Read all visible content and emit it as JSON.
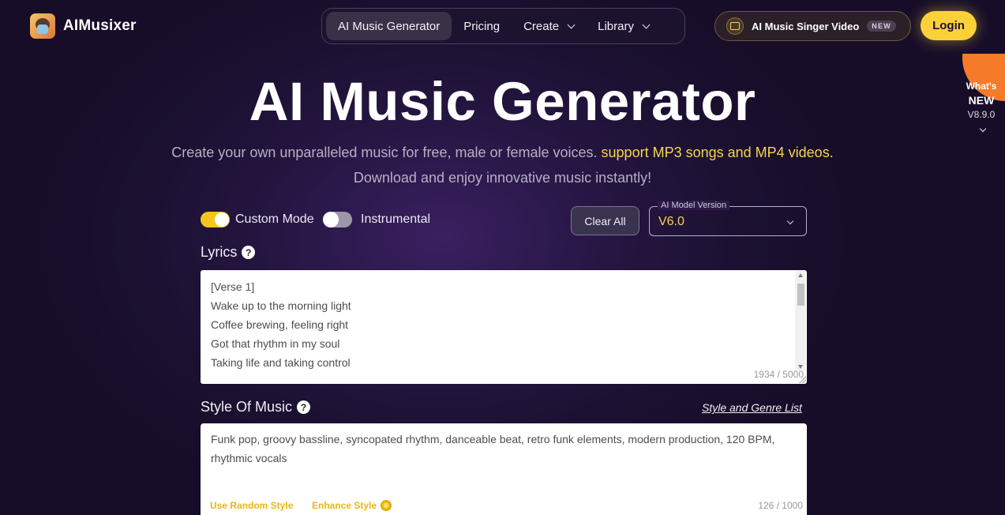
{
  "header": {
    "brand": "AIMusixer",
    "nav": [
      {
        "label": "AI Music Generator",
        "active": true
      },
      {
        "label": "Pricing"
      },
      {
        "label": "Create"
      },
      {
        "label": "Library"
      }
    ],
    "singer_video": {
      "label": "AI Music Singer Video",
      "badge": "NEW"
    },
    "login_label": "Login"
  },
  "whats_new": {
    "line1": "What's",
    "line2": "NEW",
    "version": "V8.9.0"
  },
  "hero": {
    "title": "AI Music Generator",
    "subtitle_plain": "Create your own unparalleled music for free, male or female voices. ",
    "subtitle_highlight": "support MP3 songs and MP4 videos.",
    "subtitle_line2": "Download and enjoy innovative music instantly!"
  },
  "controls": {
    "custom_mode_label": "Custom Mode",
    "custom_mode_on": true,
    "instrumental_label": "Instrumental",
    "instrumental_on": false,
    "clear_all_label": "Clear All",
    "model_legend": "AI Model Version",
    "model_value": "V6.0"
  },
  "lyrics": {
    "label": "Lyrics",
    "text": "[Verse 1]\nWake up to the morning light\nCoffee brewing, feeling right\nGot that rhythm in my soul\nTaking life and taking control",
    "counter": "1934 / 5000"
  },
  "style": {
    "label": "Style Of Music",
    "genre_link": "Style and Genre List",
    "text": "Funk pop, groovy bassline, syncopated rhythm, danceable beat, retro funk elements, modern production, 120 BPM, rhythmic vocals",
    "random_label": "Use Random Style",
    "enhance_label": "Enhance Style",
    "counter": "126 / 1000"
  },
  "colors": {
    "accent_yellow": "#fbd13a",
    "highlight_text": "#f6d54a",
    "corner_orange": "#f57a2a"
  }
}
